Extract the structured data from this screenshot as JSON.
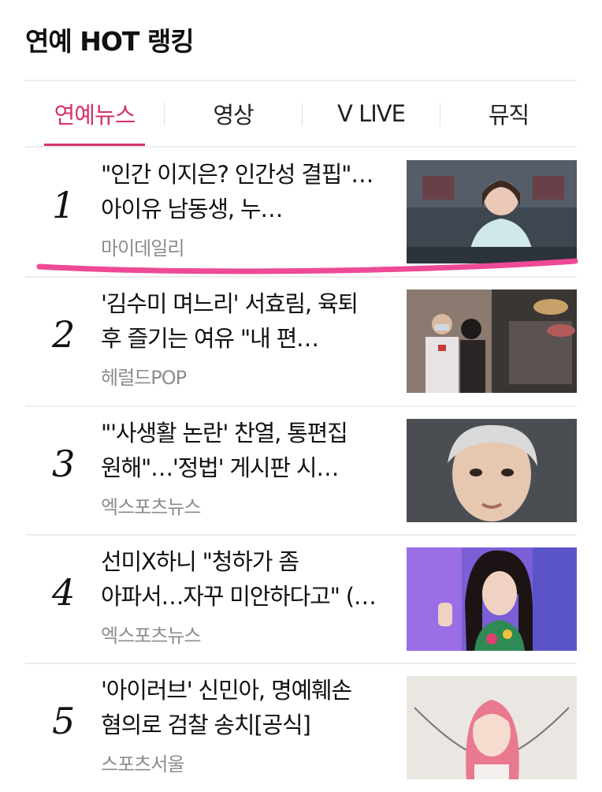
{
  "header": {
    "title": "연예 HOT 랭킹"
  },
  "tabs": [
    {
      "label": "연예뉴스",
      "active": true
    },
    {
      "label": "영상",
      "active": false
    },
    {
      "label": "V LIVE",
      "active": false
    },
    {
      "label": "뮤직",
      "active": false
    }
  ],
  "accent_color": "#d6336c",
  "annotation_color": "#ee4a96",
  "items": [
    {
      "rank": "1",
      "headline": "\"인간 이지은? 인간성 결핍\"…아이유 남동생, 누…",
      "source": "마이데일리"
    },
    {
      "rank": "2",
      "headline": "'김수미 며느리' 서효림, 육퇴 후 즐기는 여유 \"내 편…",
      "source": "헤럴드POP"
    },
    {
      "rank": "3",
      "headline": "\"'사생활 논란' 찬열, 통편집 원해\"…'정법' 게시판 시…",
      "source": "엑스포츠뉴스"
    },
    {
      "rank": "4",
      "headline": "선미X하니 \"청하가 좀 아파서…자꾸 미안하다고\" (…",
      "source": "엑스포츠뉴스"
    },
    {
      "rank": "5",
      "headline": "'아이러브' 신민아, 명예훼손 혐의로 검찰 송치[공식]",
      "source": "스포츠서울"
    }
  ]
}
